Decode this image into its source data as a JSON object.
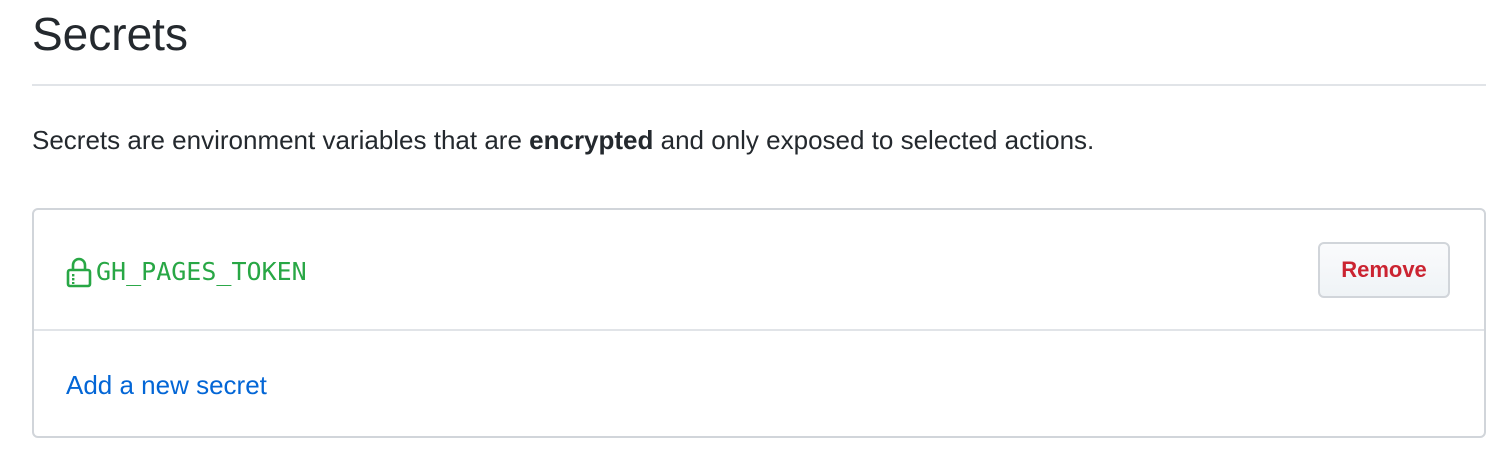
{
  "header": {
    "title": "Secrets"
  },
  "description": {
    "before": "Secrets are environment variables that are ",
    "emphasis": "encrypted",
    "after": " and only exposed to selected actions."
  },
  "secrets": {
    "items": [
      {
        "name": "GH_PAGES_TOKEN",
        "icon": "lock-icon",
        "remove_label": "Remove"
      }
    ],
    "add_link_label": "Add a new secret"
  },
  "colors": {
    "secret_name": "#28a745",
    "remove_text": "#cb2431",
    "link": "#0366d6",
    "border": "#d1d5da",
    "divider": "#e1e4e8"
  }
}
